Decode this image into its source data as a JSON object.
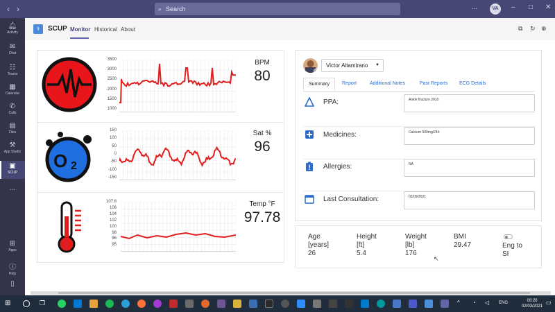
{
  "window": {
    "search_placeholder": "Search",
    "avatar_initials": "VA",
    "controls": [
      "...",
      "–",
      "□",
      "✕"
    ]
  },
  "rail": [
    {
      "label": "Activity",
      "icon": "bell-icon"
    },
    {
      "label": "Chat",
      "icon": "chat-icon"
    },
    {
      "label": "Teams",
      "icon": "teams-icon"
    },
    {
      "label": "Calendar",
      "icon": "calendar-icon"
    },
    {
      "label": "Calls",
      "icon": "phone-icon"
    },
    {
      "label": "Files",
      "icon": "file-icon"
    },
    {
      "label": "App Studio",
      "icon": "app-studio-icon"
    },
    {
      "label": "SCUP",
      "icon": "scup-icon"
    },
    {
      "label": "...",
      "icon": "more-icon"
    },
    {
      "label": "Apps",
      "icon": "apps-icon"
    },
    {
      "label": "Help",
      "icon": "help-icon"
    }
  ],
  "header": {
    "app_name": "SCUP",
    "tabs": [
      "Monitor",
      "Historical",
      "About"
    ],
    "active_tab": "Monitor"
  },
  "vitals": {
    "bpm": {
      "label": "BPM",
      "value": "80",
      "yticks": [
        "3500",
        "3000",
        "2500",
        "2000",
        "1500",
        "1000"
      ]
    },
    "sat": {
      "label": "Sat %",
      "value": "96",
      "yticks": [
        "150",
        "100",
        "50",
        "0",
        "-50",
        "-100",
        "-150"
      ]
    },
    "temp": {
      "label": "Temp °F",
      "value": "97.78",
      "yticks": [
        "107.6",
        "106",
        "104",
        "102",
        "100",
        "98",
        "96",
        "95"
      ]
    }
  },
  "doctor": {
    "name": "Victor Altamirano"
  },
  "patient_tabs": [
    "Summary",
    "Report",
    "Additional Notes",
    "Past Reports",
    "ECG Details"
  ],
  "summary": [
    {
      "label": "PPA:",
      "value": "Ankle fracture 2010",
      "icon": "triangle-icon"
    },
    {
      "label": "Medicines:",
      "value": "Calcium 500mg/24h",
      "icon": "medical-cross-icon"
    },
    {
      "label": "Allergies:",
      "value": "NA",
      "icon": "alert-clipboard-icon"
    },
    {
      "label": "Last Consultation:",
      "value": "02/09/2021",
      "icon": "calendar-icon"
    }
  ],
  "stats": {
    "age_label_1": "Age",
    "age_label_2": "[years]",
    "age_value": "26",
    "height_label_1": "Height",
    "height_label_2": "[ft]",
    "height_value": "5.4",
    "weight_label_1": "Weight",
    "weight_label_2": "[lb]",
    "weight_value": "176",
    "bmi_label": "BMI",
    "bmi_value": "29.47",
    "toggle_label_1": "Eng to",
    "toggle_label_2": "SI"
  },
  "taskbar": {
    "lang": "ENG",
    "time": "00:20",
    "date": "02/03/2021"
  },
  "colors": {
    "accent": "#6264a7",
    "signal": "#e01e1e",
    "rail": "#33344a",
    "titlebar": "#464775"
  }
}
